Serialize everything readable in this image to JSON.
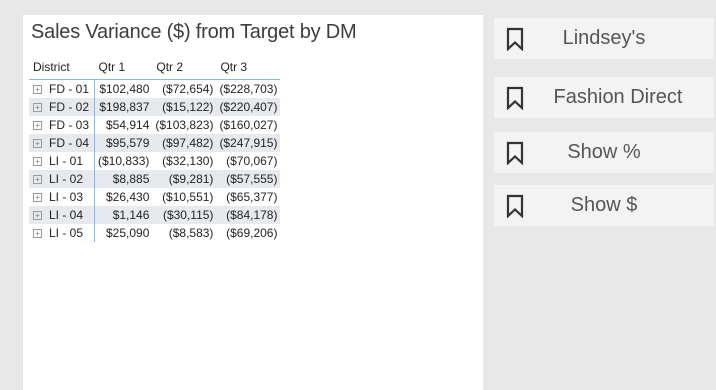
{
  "visual": {
    "title": "Sales Variance ($) from Target by DM",
    "columns": [
      "District",
      "Qtr 1",
      "Qtr 2",
      "Qtr 3"
    ],
    "rows": [
      {
        "district": "FD - 01",
        "q1": "$102,480",
        "q2": "($72,654)",
        "q3": "($228,703)"
      },
      {
        "district": "FD - 02",
        "q1": "$198,837",
        "q2": "($15,122)",
        "q3": "($220,407)"
      },
      {
        "district": "FD - 03",
        "q1": "$54,914",
        "q2": "($103,823)",
        "q3": "($160,027)"
      },
      {
        "district": "FD - 04",
        "q1": "$95,579",
        "q2": "($97,482)",
        "q3": "($247,915)"
      },
      {
        "district": "LI - 01",
        "q1": "($10,833)",
        "q2": "($32,130)",
        "q3": "($70,067)"
      },
      {
        "district": "LI - 02",
        "q1": "$8,885",
        "q2": "($9,281)",
        "q3": "($57,555)"
      },
      {
        "district": "LI - 03",
        "q1": "$26,430",
        "q2": "($10,551)",
        "q3": "($65,377)"
      },
      {
        "district": "LI - 04",
        "q1": "$1,146",
        "q2": "($30,115)",
        "q3": "($84,178)"
      },
      {
        "district": "LI - 05",
        "q1": "$25,090",
        "q2": "($8,583)",
        "q3": "($69,206)"
      }
    ]
  },
  "bookmarks": [
    {
      "label": "Lindsey's",
      "icon": "bookmark-icon"
    },
    {
      "label": "Fashion Direct",
      "icon": "bookmark-icon"
    },
    {
      "label": "Show %",
      "icon": "bookmark-icon"
    },
    {
      "label": "Show $",
      "icon": "bookmark-icon"
    }
  ],
  "colors": {
    "accent": "#8fb7d6",
    "alt_row": "#e6e9ed",
    "panel": "#f3f3f3"
  }
}
